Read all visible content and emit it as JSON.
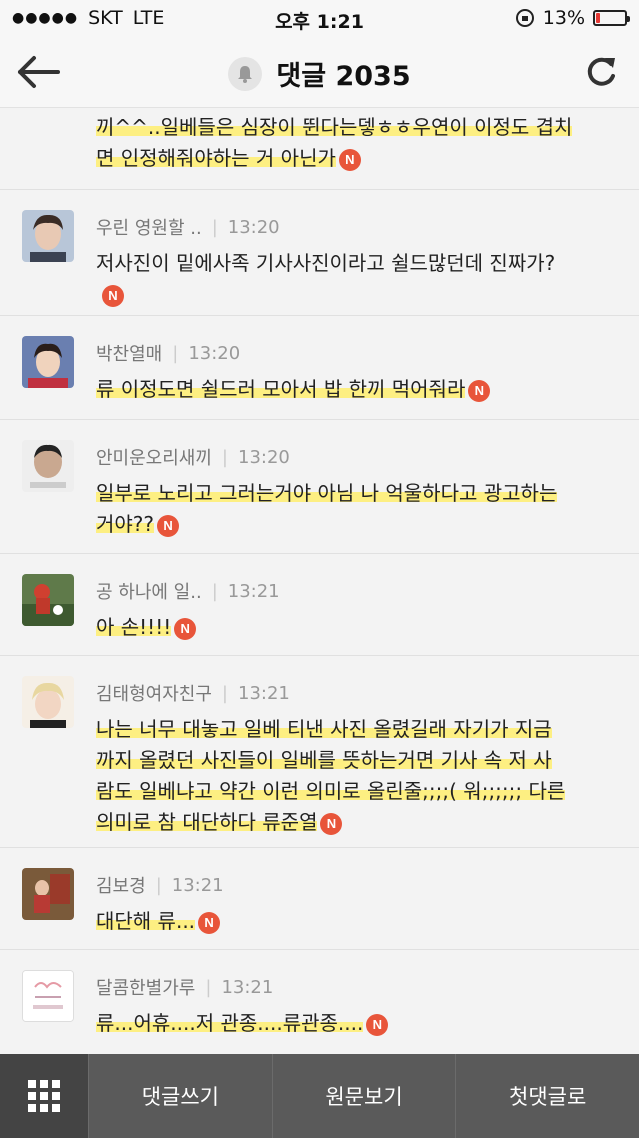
{
  "status_bar": {
    "carrier": "SKT",
    "network": "LTE",
    "time": "오후 1:21",
    "battery": "13%",
    "battery_level": 0.13,
    "battery_color": "#e53935"
  },
  "header": {
    "title": "댓글 2035",
    "back_icon": "arrow-left-icon",
    "bell_icon": "bell-icon",
    "refresh_icon": "refresh-icon"
  },
  "comments": [
    {
      "author": "",
      "time": "",
      "line1": "끼^^..일베들은 심장이 뛴다는뎋ㅎㅎ우연이 이정도 겹치",
      "line2": "면 인정해줘야하는 거 아닌가",
      "badge": "N"
    },
    {
      "author": "우린 영원할 ..",
      "time": "13:20",
      "line1": "저사진이 밑에사족 기사사진이라고 쉴드많던데 진짜가?",
      "badge": "N"
    },
    {
      "author": "박찬열매",
      "time": "13:20",
      "line1": "류 이정도면 쉴드러 모아서 밥 한끼 먹어줘라",
      "badge": "N"
    },
    {
      "author": "안미운오리새끼",
      "time": "13:20",
      "line1": "일부로 노리고 그러는거야 아님 나 억울하다고 광고하는",
      "line2": "거야??",
      "badge": "N"
    },
    {
      "author": "공 하나에 일..",
      "time": "13:21",
      "line1": "아 손!!!!",
      "badge": "N"
    },
    {
      "author": "김태형여자친구",
      "time": "13:21",
      "line1": "나는 너무 대놓고 일베 티낸 사진 올렸길래 자기가 지금",
      "line2": "까지 올렸던 사진들이 일베를 뜻하는거면 기사 속 저 사",
      "line3": "람도 일베냐고 약간 이런 의미로 올린줄;;;;( 워;;;;;; 다른",
      "line4": "의미로 참 대단하다 류준열",
      "badge": "N"
    },
    {
      "author": "김보경",
      "time": "13:21",
      "line1": "대단해 류...",
      "badge": "N"
    },
    {
      "author": "달콤한별가루",
      "time": "13:21",
      "line1": "류...어휴....저 관종....류관종....",
      "badge": "N"
    }
  ],
  "bottom_bar": {
    "menu_icon": "grid-menu-icon",
    "write": "댓글쓰기",
    "original": "원문보기",
    "first": "첫댓글로"
  },
  "colors": {
    "highlight": "#ffee6e",
    "badge": "#e8553a",
    "bottom_bar": "#5a5a5a"
  }
}
